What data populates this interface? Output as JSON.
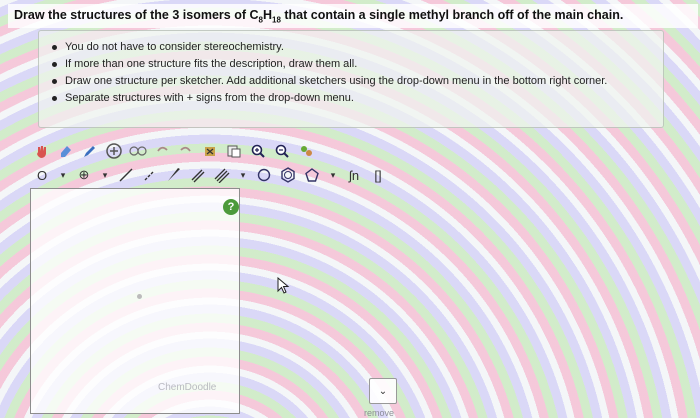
{
  "question": {
    "prefix": "Draw the structures of the 3 isomers of C",
    "c_sub": "8",
    "mid": "H",
    "h_sub": "18",
    "suffix": " that contain a single methyl branch off of the main chain."
  },
  "hints": [
    "You do not have to consider stereochemistry.",
    "If more than one structure fits the description, draw them all.",
    "Draw one structure per sketcher. Add additional sketchers using the drop-down menu in the bottom right corner.",
    "Separate structures with + signs from the drop-down menu."
  ],
  "toolbar": {
    "row1_icons": [
      "hand-icon",
      "eraser-icon",
      "pencil-icon",
      "ring-plus-icon",
      "template-icon",
      "undo-icon",
      "redo-icon",
      "clear-icon",
      "copy-icon",
      "zoom-in-icon",
      "zoom-out-icon",
      "settings-icon"
    ],
    "element_label": "O",
    "charge_label": "⊕",
    "fn_label": "ʃn",
    "bracket_label": "[]"
  },
  "canvas": {
    "help_label": "?",
    "watermark": "ChemDoodle"
  },
  "dropdown": {
    "symbol": "⌄"
  },
  "remove_link": "remove"
}
